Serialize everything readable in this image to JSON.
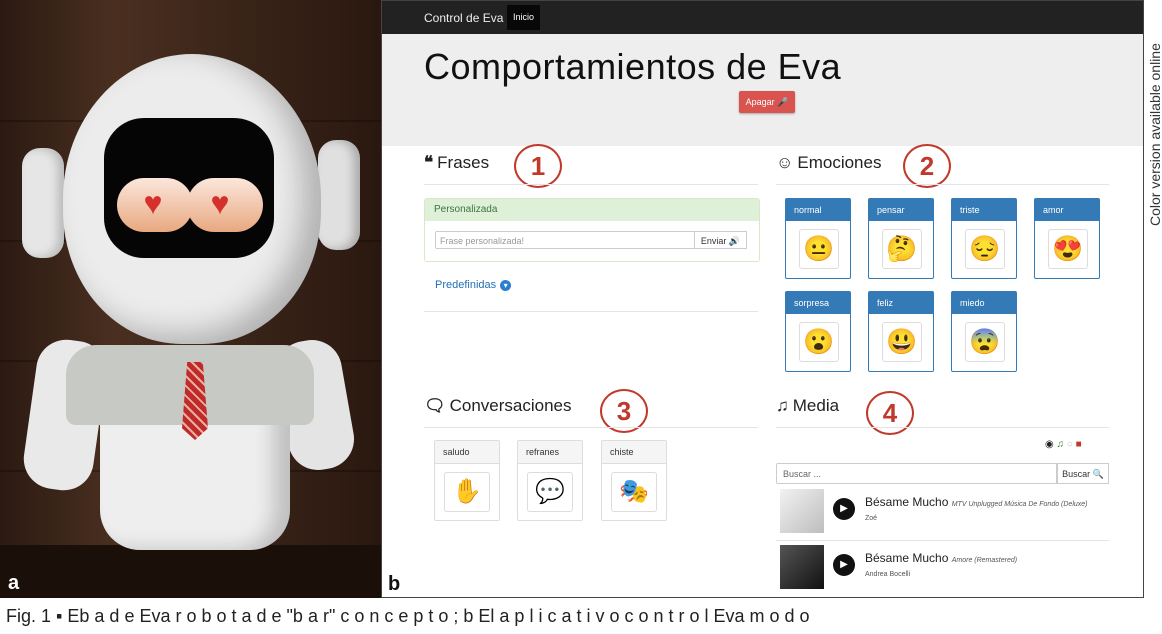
{
  "panel_a": {
    "label": "a"
  },
  "panel_b": {
    "label": "b",
    "navbar": {
      "brand": "Control de Eva",
      "active_item": "Inicio"
    },
    "header": {
      "title": "Comportamientos de Eva",
      "off_button": "Apagar"
    },
    "phrases": {
      "title": "Frases",
      "callout": "1",
      "panel_heading": "Personalizada",
      "input_placeholder": "Frase personalizada!",
      "send_button": "Enviar",
      "predefined_link": "Predefinidas"
    },
    "emotions": {
      "title": "Emociones",
      "callout": "2",
      "items": [
        {
          "label": "normal",
          "icon": "neutral-face-icon",
          "glyph": "😐"
        },
        {
          "label": "pensar",
          "icon": "thinking-face-icon",
          "glyph": "🤔"
        },
        {
          "label": "triste",
          "icon": "sad-face-icon",
          "glyph": "😔"
        },
        {
          "label": "amor",
          "icon": "heart-eyes-face-icon",
          "glyph": "😍"
        },
        {
          "label": "sorpresa",
          "icon": "surprised-face-icon",
          "glyph": "😮"
        },
        {
          "label": "feliz",
          "icon": "grinning-face-icon",
          "glyph": "😃"
        },
        {
          "label": "miedo",
          "icon": "fearful-face-icon",
          "glyph": "😨"
        }
      ]
    },
    "conversations": {
      "title": "Conversaciones",
      "callout": "3",
      "items": [
        {
          "label": "saludo",
          "icon": "waving-hand-icon",
          "glyph": "✋"
        },
        {
          "label": "refranes",
          "icon": "quote-bubble-icon",
          "glyph": "💬"
        },
        {
          "label": "chiste",
          "icon": "joke-mask-icon",
          "glyph": "🎭"
        }
      ]
    },
    "media": {
      "title": "Media",
      "callout": "4",
      "search_placeholder": "Buscar ...",
      "search_button": "Buscar",
      "tracks": [
        {
          "title": "Bésame Mucho",
          "album": "MTV Unplugged Música De Fondo (Deluxe)",
          "artist": "Zoé"
        },
        {
          "title": "Bésame Mucho",
          "album": "Amore (Remastered)",
          "artist": "Andrea Bocelli"
        }
      ]
    }
  },
  "side_note": "Color version available online",
  "caption": "Fig. 1 ▪ Eb  a  d  e   Eva   r  o  b  o t  a  d e  \"b  a  r\"   c  o  n  c  e p  t  o ;  b  El  a  p  l  i c  a  t i  v  o   c  o  n  t r o  l  Eva   m  o  d  o",
  "colors": {
    "navbar": "#222222",
    "danger": "#d9534f",
    "primary": "#337ab7",
    "success_bg": "#dff0d8",
    "callout": "#c0392b"
  }
}
